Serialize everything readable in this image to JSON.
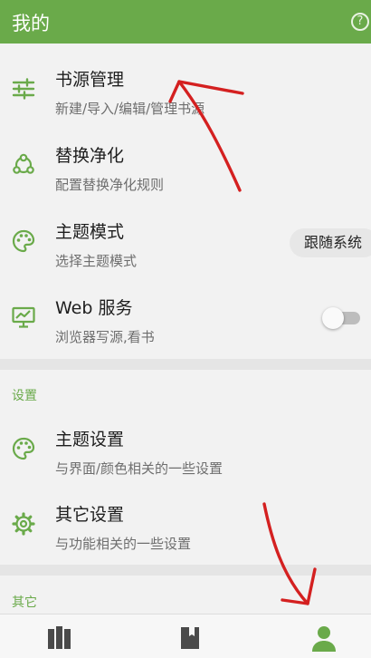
{
  "appbar": {
    "title": "我的",
    "help_icon": "help-circle-icon",
    "help_glyph": "?"
  },
  "menu": [
    {
      "title": "书源管理",
      "subtitle": "新建/导入/编辑/管理书源",
      "icon": "sliders-icon"
    },
    {
      "title": "替换净化",
      "subtitle": "配置替换净化规则",
      "icon": "share-nodes-icon"
    },
    {
      "title": "主题模式",
      "subtitle": "选择主题模式",
      "icon": "palette-icon",
      "value": "跟随系统"
    },
    {
      "title": "Web 服务",
      "subtitle": "浏览器写源,看书",
      "icon": "monitor-chart-icon",
      "toggle_on": false
    }
  ],
  "settings_section": {
    "label": "设置",
    "items": [
      {
        "title": "主题设置",
        "subtitle": "与界面/颜色相关的一些设置",
        "icon": "palette-icon"
      },
      {
        "title": "其它设置",
        "subtitle": "与功能相关的一些设置",
        "icon": "gear-icon"
      }
    ]
  },
  "other_section": {
    "label": "其它"
  },
  "bottom_nav": {
    "tabs": [
      {
        "icon": "bookshelf-icon",
        "selected": false
      },
      {
        "icon": "book-icon",
        "selected": false
      },
      {
        "icon": "person-icon",
        "selected": true
      }
    ]
  },
  "colors": {
    "primary": "#6aaa4a",
    "annotation": "#d42020"
  }
}
